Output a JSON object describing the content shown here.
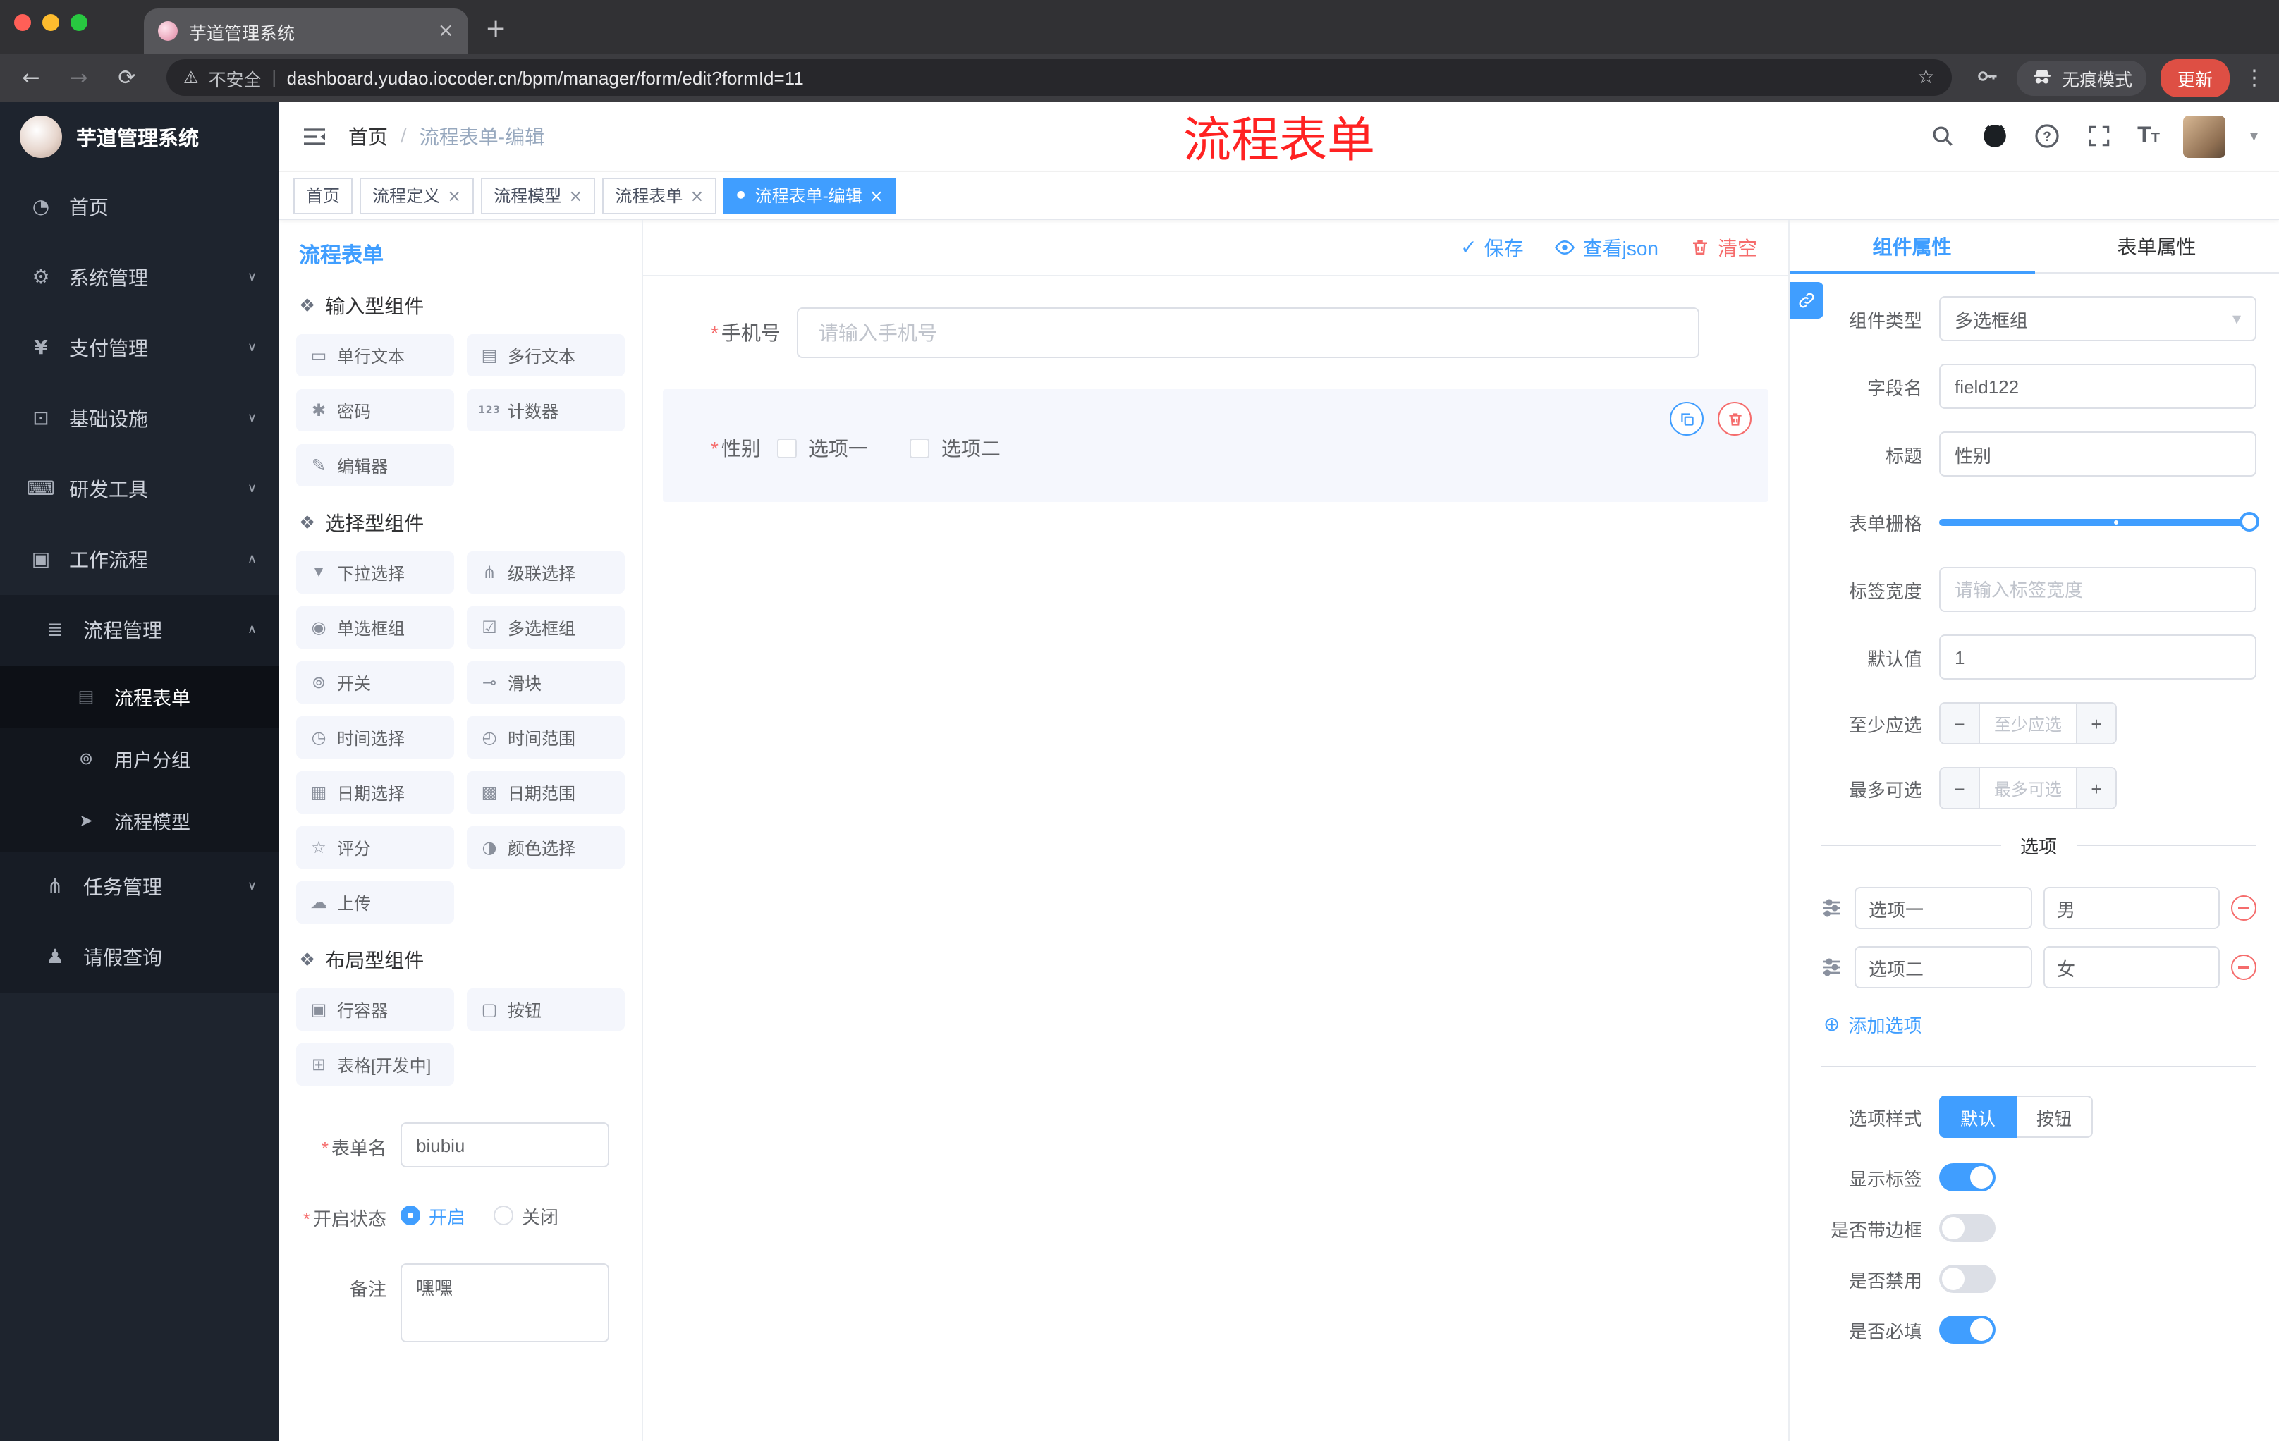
{
  "colors": {
    "accent_blue": "#409eff",
    "danger_red": "#f56c6c",
    "annotation_red": "#ff2222",
    "sidebar_bg": "#1e242e"
  },
  "browser": {
    "tab": {
      "title": "芋道管理系统"
    },
    "address": {
      "security": "不安全",
      "url": "dashboard.yudao.iocoder.cn/bpm/manager/form/edit?formId=11"
    },
    "incognito": "无痕模式",
    "update": "更新"
  },
  "sidebar": {
    "logo": "芋道管理系统",
    "menu": [
      {
        "label": "首页"
      },
      {
        "label": "系统管理"
      },
      {
        "label": "支付管理"
      },
      {
        "label": "基础设施"
      },
      {
        "label": "研发工具"
      },
      {
        "label": "工作流程"
      }
    ],
    "workflow": {
      "process_mgmt": {
        "label": "流程管理",
        "children": [
          {
            "label": "流程表单"
          },
          {
            "label": "用户分组"
          },
          {
            "label": "流程模型"
          }
        ]
      },
      "task_mgmt": {
        "label": "任务管理"
      },
      "leave_query": {
        "label": "请假查询"
      }
    }
  },
  "header": {
    "breadcrumb": [
      "首页",
      "流程表单-编辑"
    ],
    "annotation": "流程表单"
  },
  "tags": [
    {
      "label": "首页"
    },
    {
      "label": "流程定义"
    },
    {
      "label": "流程模型"
    },
    {
      "label": "流程表单"
    },
    {
      "label": "流程表单-编辑"
    }
  ],
  "palette": {
    "title": "流程表单",
    "groups": [
      {
        "title": "输入型组件",
        "items": [
          "单行文本",
          "多行文本",
          "密码",
          "计数器",
          "编辑器"
        ]
      },
      {
        "title": "选择型组件",
        "items": [
          "下拉选择",
          "级联选择",
          "单选框组",
          "多选框组",
          "开关",
          "滑块",
          "时间选择",
          "时间范围",
          "日期选择",
          "日期范围",
          "评分",
          "颜色选择",
          "上传"
        ]
      },
      {
        "title": "布局型组件",
        "items": [
          "行容器",
          "按钮",
          "表格[开发中]"
        ]
      }
    ],
    "form": {
      "name_label": "表单名",
      "name_value": "biubiu",
      "status_label": "开启状态",
      "status_on": "开启",
      "status_off": "关闭",
      "remark_label": "备注",
      "remark_value": "嘿嘿"
    }
  },
  "canvas": {
    "toolbar": {
      "save": "保存",
      "view_json": "查看json",
      "clear": "清空"
    },
    "fields": [
      {
        "label": "手机号",
        "placeholder": "请输入手机号"
      },
      {
        "label": "性别",
        "options": [
          "选项一",
          "选项二"
        ]
      }
    ]
  },
  "inspector": {
    "tabs": [
      "组件属性",
      "表单属性"
    ],
    "fields": {
      "component_type": {
        "label": "组件类型",
        "value": "多选框组"
      },
      "field_name": {
        "label": "字段名",
        "value": "field122"
      },
      "title": {
        "label": "标题",
        "value": "性别"
      },
      "grid": {
        "label": "表单栅格"
      },
      "label_width": {
        "label": "标签宽度",
        "placeholder": "请输入标签宽度"
      },
      "default": {
        "label": "默认值",
        "value": "1"
      },
      "min": {
        "label": "至少应选",
        "placeholder": "至少应选"
      },
      "max": {
        "label": "最多可选",
        "placeholder": "最多可选"
      }
    },
    "options": {
      "divider": "选项",
      "rows": [
        {
          "label": "选项一",
          "value": "男"
        },
        {
          "label": "选项二",
          "value": "女"
        }
      ],
      "add": "添加选项"
    },
    "style": {
      "label": "选项样式",
      "choices": [
        "默认",
        "按钮"
      ]
    },
    "switches": [
      {
        "label": "显示标签",
        "on": true
      },
      {
        "label": "是否带边框",
        "on": false
      },
      {
        "label": "是否禁用",
        "on": false
      },
      {
        "label": "是否必填",
        "on": true
      }
    ]
  }
}
